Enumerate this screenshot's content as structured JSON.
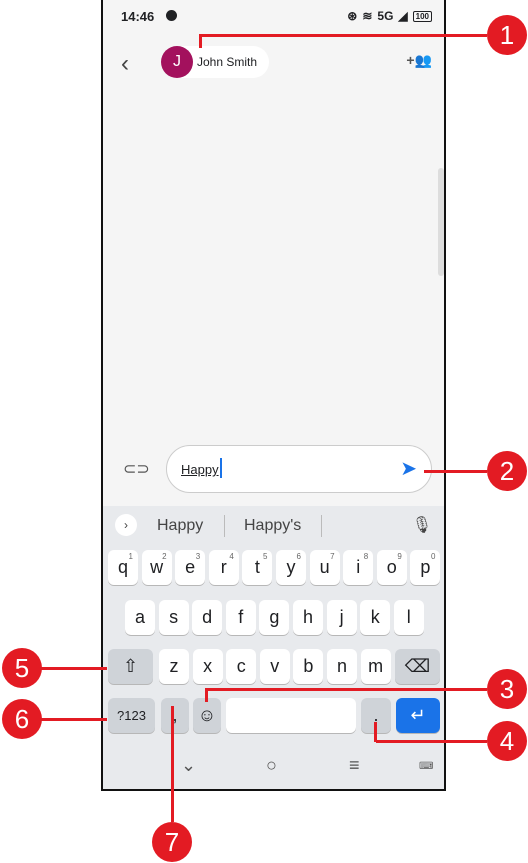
{
  "status_bar": {
    "time": "14:46",
    "network": "5G",
    "battery": "100"
  },
  "topbar": {
    "contact_initial": "J",
    "contact_name": "John Smith"
  },
  "composer": {
    "text": "Happy"
  },
  "suggestions": [
    "Happy",
    "Happy's"
  ],
  "keyboard": {
    "row1": [
      {
        "k": "q",
        "s": "1"
      },
      {
        "k": "w",
        "s": "2"
      },
      {
        "k": "e",
        "s": "3"
      },
      {
        "k": "r",
        "s": "4"
      },
      {
        "k": "t",
        "s": "5"
      },
      {
        "k": "y",
        "s": "6"
      },
      {
        "k": "u",
        "s": "7"
      },
      {
        "k": "i",
        "s": "8"
      },
      {
        "k": "o",
        "s": "9"
      },
      {
        "k": "p",
        "s": "0"
      }
    ],
    "row2": [
      "a",
      "s",
      "d",
      "f",
      "g",
      "h",
      "j",
      "k",
      "l"
    ],
    "row3": [
      "z",
      "x",
      "c",
      "v",
      "b",
      "n",
      "m"
    ],
    "symbols_label": "?123",
    "comma": ",",
    "period": "."
  },
  "callouts": [
    "1",
    "2",
    "3",
    "4",
    "5",
    "6",
    "7"
  ],
  "colors": {
    "accent": "#1a73e8",
    "callout": "#e31b23",
    "avatar": "#a3115d"
  }
}
